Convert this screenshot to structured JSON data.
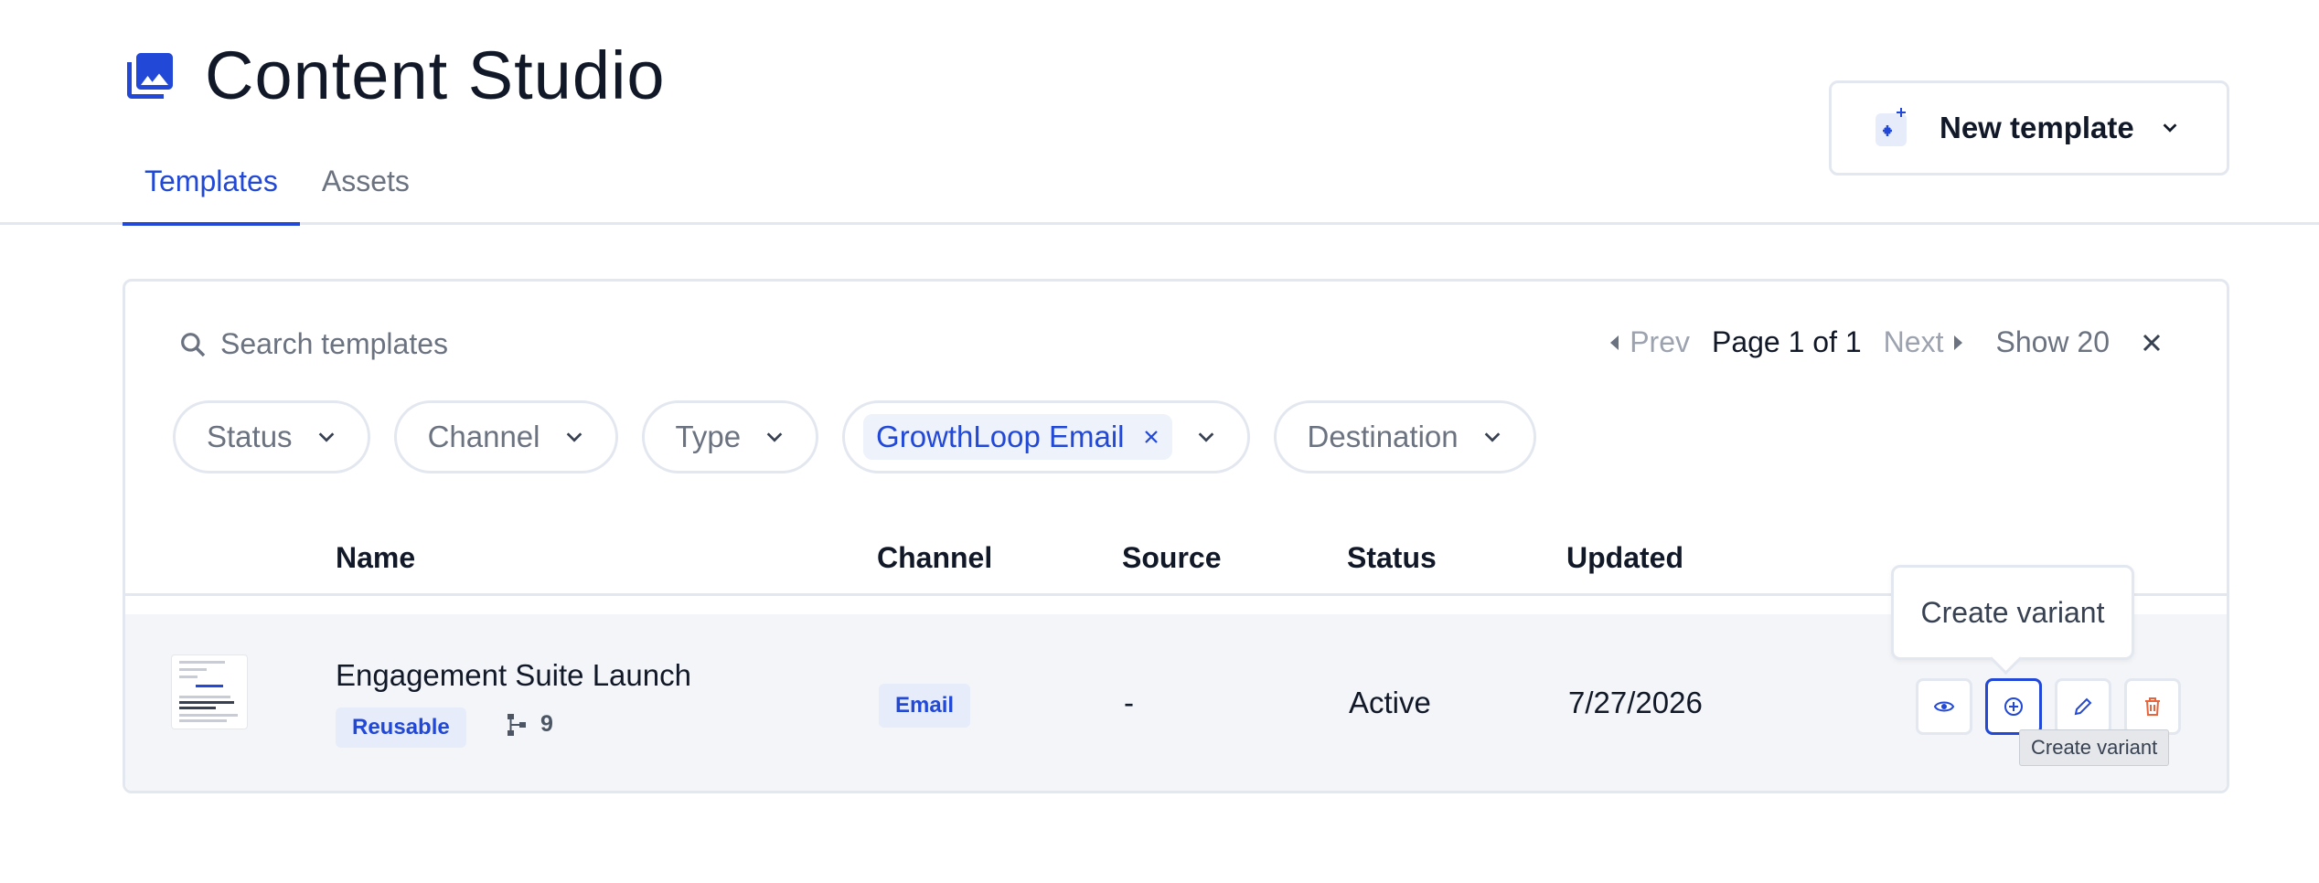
{
  "header": {
    "title": "Content Studio",
    "title_icon": "image-gallery-icon",
    "tabs": [
      {
        "label": "Templates",
        "active": true
      },
      {
        "label": "Assets",
        "active": false
      }
    ],
    "new_template": {
      "label": "New template",
      "icon": "sparkle-icon"
    }
  },
  "toolbar": {
    "search_placeholder": "Search templates",
    "pager": {
      "prev": "Prev",
      "page": "Page 1 of 1",
      "next": "Next",
      "show": "Show 20"
    }
  },
  "filters": {
    "status": "Status",
    "channel": "Channel",
    "type": "Type",
    "active_chip": "GrowthLoop Email",
    "destination": "Destination"
  },
  "table": {
    "columns": [
      "Name",
      "Channel",
      "Source",
      "Status",
      "Updated"
    ],
    "rows": [
      {
        "name": "Engagement Suite Launch",
        "tag": "Reusable",
        "variants": "9",
        "channel": "Email",
        "source": "-",
        "status": "Active",
        "updated": "7/27/2026"
      }
    ]
  },
  "popover": {
    "label": "Create variant"
  },
  "tooltip": {
    "label": "Create variant"
  },
  "colors": {
    "accent": "#2148d6",
    "danger": "#e8643c",
    "border": "#e3e7ef",
    "row_bg": "#f3f5f9"
  }
}
